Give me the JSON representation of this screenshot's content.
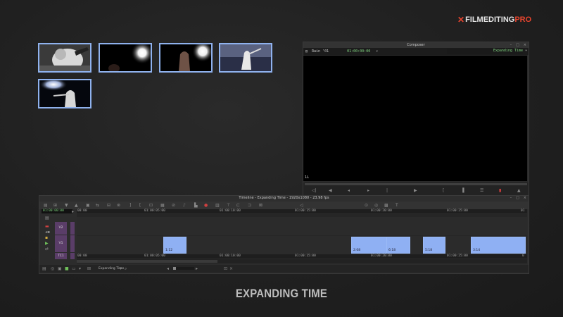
{
  "logo": {
    "mark": "✕",
    "text_a": "FILMEDITING",
    "text_b": "PRO"
  },
  "bin_thumbnails": [
    {
      "name": "baseball-player-1"
    },
    {
      "name": "stadium-light-1"
    },
    {
      "name": "batter-hand-light"
    },
    {
      "name": "batter-stadium-crowd"
    },
    {
      "name": "batter-swing-light"
    }
  ],
  "composer": {
    "title": "Composer",
    "clip_name": "Rain '01",
    "timecode": "01:00:00:00",
    "sequence_name": "Expanding Time",
    "overlay_text": "1L"
  },
  "timeline": {
    "title": "Timeline - Expanding Time - 1920x1080 - 23.98 fps",
    "timecode": "01:00:00:00",
    "ruler_marks": [
      "00:00",
      "01:00:05:00",
      "01:00:10:00",
      "01:00:15:00",
      "01:00:20:00",
      "01:00:25:00",
      "01"
    ],
    "ruler_marks_bottom": [
      "00:00",
      "01:00:05:00",
      "01:00:10:00",
      "01:00:15:00",
      "01:00:20:00",
      "01:00:25:00",
      "0"
    ],
    "tracks": {
      "v2": "V2",
      "v1": "V1",
      "tc1": "TC1"
    },
    "clips": [
      {
        "label": "1:12"
      },
      {
        "label": "2:08"
      },
      {
        "label": "6:18"
      },
      {
        "label": "5:18"
      },
      {
        "label": "3:14"
      }
    ],
    "sequence_menu": "Expanding Time"
  },
  "caption": "EXPANDING TIME",
  "colors": {
    "accent_red": "#e8452e",
    "clip_blue": "#8fb0f3",
    "thumb_border": "#8fb2ee",
    "track_purple": "#5a3d68",
    "timecode_green": "#7fd47f"
  }
}
